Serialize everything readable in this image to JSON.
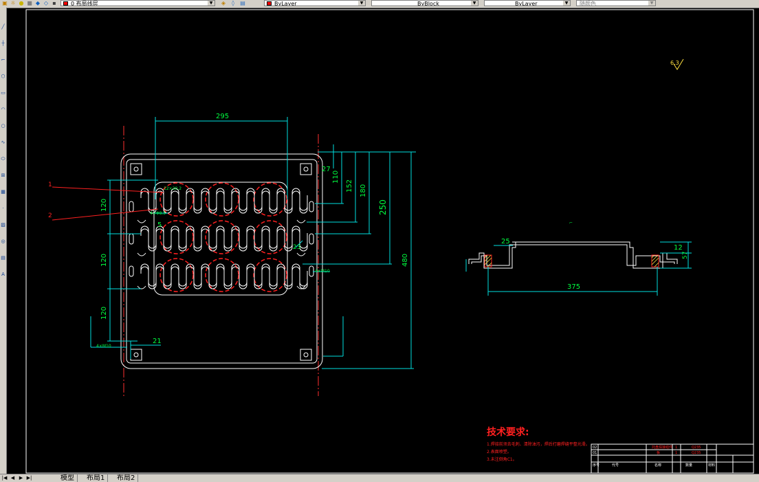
{
  "toolbar": {
    "layer_combo": "0 布局线层",
    "color_combo": "ByLayer",
    "linetype_combo": "ByBlock",
    "lineweight_combo": "ByLayer",
    "plotstyle_combo": "随颜色"
  },
  "tabs": {
    "model": "模型",
    "layout1": "布局1",
    "layout2": "布局2"
  },
  "drawing": {
    "dims": {
      "d295": "295",
      "d27": "27",
      "d110": "110",
      "d152": "152",
      "d180": "180",
      "d250": "250",
      "d480": "480",
      "d120a": "120",
      "d120b": "120",
      "d120c": "120",
      "d21": "21",
      "d5": "5",
      "d23": "23",
      "d25": "25",
      "d12": "12",
      "d57": "57",
      "d375": "375"
    },
    "leaders": {
      "l1": "1",
      "l2": "2"
    },
    "small_labels": {
      "s1": "12×20.2",
      "s2": "4×Φ8.5",
      "s3": "4×M10",
      "s4": "4×M10"
    },
    "roughness": "6.3"
  },
  "tech_req": {
    "title": "技术要求:",
    "items": [
      "1.焊接前须去毛刺、清除油污，焊后打磨焊缝平整光滑。",
      "2.表面喷塑。",
      "3.未注倒角C1。"
    ]
  },
  "title_block": {
    "rows": [
      "02",
      "01"
    ],
    "part_a": "托盘焊接组件",
    "part_b": "板",
    "qty_a": "1",
    "qty_b": "1",
    "mat_a": "Q235",
    "mat_b": "Q235",
    "hdr": [
      "序号",
      "代号",
      "名称",
      "数量",
      "材料"
    ]
  }
}
